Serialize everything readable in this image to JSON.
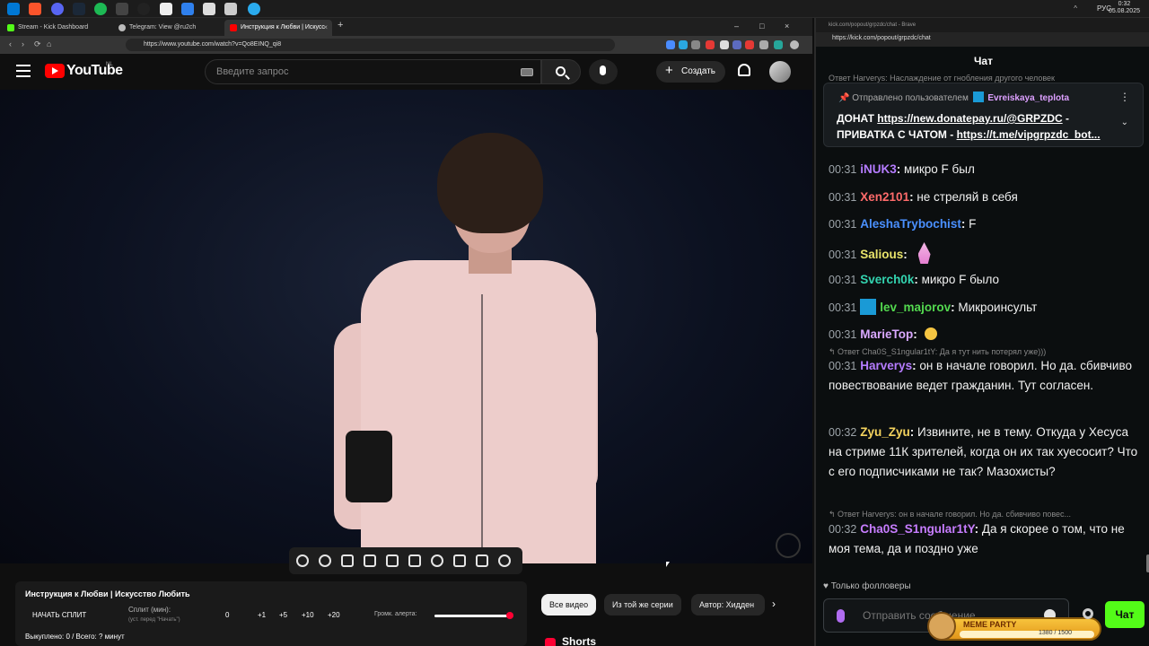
{
  "taskbar": {
    "time": "0:32",
    "date": "05.08.2025",
    "lang": "РУС",
    "tray": "^"
  },
  "browserL": {
    "tabs": [
      {
        "label": "Stream - Kick Dashboard",
        "close": ""
      },
      {
        "label": "Telegram: View @ru2ch",
        "close": ""
      },
      {
        "label": "Инструкция к Любви | Искусс",
        "close": "×"
      }
    ],
    "new_tab": "+",
    "win_controls": [
      "–",
      "□",
      "×"
    ],
    "url": "https://www.youtube.com/watch?v=Qo8EINQ_qi8",
    "nav": [
      "‹",
      "›",
      "⟳",
      "⌂"
    ]
  },
  "youtube": {
    "logo_text": "YouTube",
    "region": "NL",
    "search_placeholder": "Введите запрос",
    "create_label": "Создать",
    "create_icon": "+",
    "colors": {
      "brand": "#ff0000",
      "bg": "#0f0f0f"
    }
  },
  "split_panel": {
    "title": "Инструкция к Любви | Искусство Любить",
    "start_label": "НАЧАТЬ СПЛИТ",
    "split_label": "Сплит (мин):",
    "split_hint": "(уст. перед \"Начать\")",
    "split_value": "0",
    "increments": [
      "+1",
      "+5",
      "+10",
      "+20"
    ],
    "volume_label": "Громк. алерта:",
    "volume_level": 0.95,
    "footer": "Выкуплено: 0 / Всего: ? минут"
  },
  "chips": [
    "Все видео",
    "Из той же серии",
    "Автор: Хидден"
  ],
  "chips_next": "›",
  "shorts_label": "Shorts",
  "chat": {
    "window_title": "kick.com/popout/grpzdc/chat - Brave",
    "url": "https://kick.com/popout/grpzdc/chat",
    "header": "Чат",
    "reply_top": "Ответ Harverys: Наслаждение от гнобления другого человек",
    "pinned": {
      "prefix": "Отправлено пользователем",
      "user": "Evreiskaya_teplota",
      "more": "⋮",
      "chev": "⌄",
      "line1_a": "ДОНАТ ",
      "line1_link": "https://new.donatepay.ru/@GRPZDC",
      "line1_b": " -",
      "line2_a": "ПРИВАТКА С ЧАТОМ - ",
      "line2_link": "https://t.me/vipgrpzdc_bot..."
    },
    "messages": [
      {
        "time": "00:31",
        "user": "iNUK3",
        "color": "#b57cff",
        "text": "микро F был"
      },
      {
        "time": "00:31",
        "user": "Xen2101",
        "color": "#ff6b6b",
        "text": "не стреляй в себя"
      },
      {
        "time": "00:31",
        "user": "AleshaTrybochist",
        "color": "#4a90ff",
        "text": "F"
      },
      {
        "time": "00:31",
        "user": "Salious",
        "color": "#e8e36a",
        "text": "",
        "emote": "gem"
      },
      {
        "time": "00:31",
        "user": "Sverch0k",
        "color": "#33d4b0",
        "text": "микро F было"
      },
      {
        "time": "00:31",
        "user": "lev_majorov",
        "color": "#53d94f",
        "text": "Микроинсульт",
        "badge": true
      },
      {
        "time": "00:31",
        "user": "MarieTop",
        "color": "#d9a8ff",
        "text": "",
        "emote": "face"
      },
      {
        "time": "00:31",
        "user": "Harverys",
        "color": "#b57cff",
        "text": "он в начале говорил. Но да. сбивчиво повествование ведет гражданин. Тут согласен.",
        "reply": "Ответ Cha0S_S1ngular1tY: Да я тут нить потерял уже)))"
      },
      {
        "time": "00:32",
        "user": "Zyu_Zyu",
        "color": "#f4d35e",
        "text": "Извините, не в тему. Откуда у Хесуса на стриме 11К зрителей, когда он их так хуесосит? Что с его подписчиками не так? Мазохисты?"
      },
      {
        "time": "00:32",
        "user": "Cha0S_S1ngular1tY",
        "color": "#c77dff",
        "text": "Да я скорее о том, что не моя тема, да и поздно уже",
        "reply": "Ответ Harverys: он в начале говорил. Но да. сбивчиво повес..."
      }
    ],
    "followers_only": "Только фолловеры",
    "input_placeholder": "Отправить сообщение",
    "meme_party": "MEME PARTY",
    "meme_count": "1380 / 1500",
    "send_label": "Чат",
    "accent": "#53fc18"
  }
}
